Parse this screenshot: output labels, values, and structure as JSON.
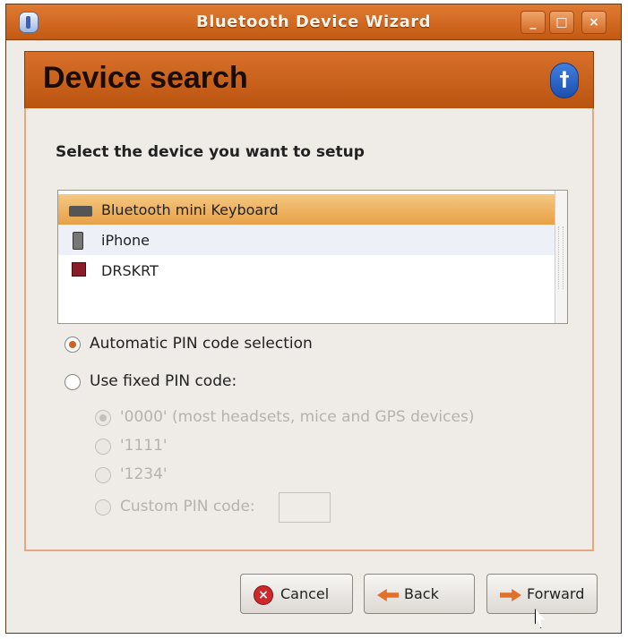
{
  "window": {
    "title": "Bluetooth Device Wizard"
  },
  "header": {
    "title": "Device search"
  },
  "instruction": "Select the device you want to setup",
  "devices": [
    {
      "label": "Bluetooth mini Keyboard",
      "icon": "keyboard-icon",
      "selected": true
    },
    {
      "label": "iPhone",
      "icon": "phone-icon",
      "selected": false
    },
    {
      "label": "DRSKRT",
      "icon": "computer-icon",
      "selected": false
    }
  ],
  "pin_options": {
    "automatic_label": "Automatic PIN code selection",
    "fixed_label": "Use fixed PIN code:",
    "fixed_choices": [
      "'0000' (most headsets, mice and GPS devices)",
      "'1111'",
      "'1234'",
      "Custom PIN code:"
    ],
    "custom_value": ""
  },
  "buttons": {
    "cancel": "Cancel",
    "back": "Back",
    "forward": "Forward"
  },
  "colors": {
    "accent": "#d2621c",
    "titlebar": "#c35a14",
    "selection": "#f0b868"
  }
}
